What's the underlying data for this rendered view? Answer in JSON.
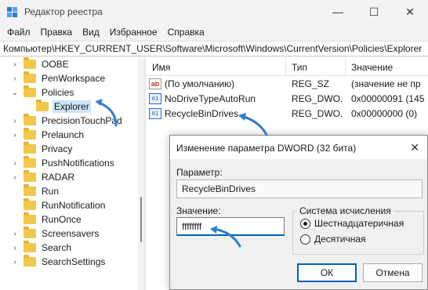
{
  "window": {
    "title": "Редактор реестра"
  },
  "window_controls": {
    "minimize": "—",
    "maximize": "☐",
    "close": "✕"
  },
  "menu": [
    "Файл",
    "Правка",
    "Вид",
    "Избранное",
    "Справка"
  ],
  "address": "Компьютер\\HKEY_CURRENT_USER\\Software\\Microsoft\\Windows\\CurrentVersion\\Policies\\Explorer",
  "tree": {
    "items": [
      {
        "label": "OOBE",
        "expander": "›"
      },
      {
        "label": "PenWorkspace",
        "expander": "›"
      },
      {
        "label": "Policies",
        "expander": "⌄"
      },
      {
        "label": "Explorer",
        "expander": "",
        "selected": true
      },
      {
        "label": "PrecisionTouchPad",
        "expander": "›"
      },
      {
        "label": "Prelaunch",
        "expander": "›"
      },
      {
        "label": "Privacy",
        "expander": ""
      },
      {
        "label": "PushNotifications",
        "expander": "›"
      },
      {
        "label": "RADAR",
        "expander": "›"
      },
      {
        "label": "Run",
        "expander": ""
      },
      {
        "label": "RunNotification",
        "expander": ""
      },
      {
        "label": "RunOnce",
        "expander": ""
      },
      {
        "label": "Screensavers",
        "expander": "›"
      },
      {
        "label": "Search",
        "expander": "›"
      },
      {
        "label": "SearchSettings",
        "expander": "›"
      }
    ]
  },
  "list": {
    "headers": {
      "name": "Имя",
      "type": "Тип",
      "value": "Значение"
    },
    "rows": [
      {
        "icon": "string-value-icon",
        "glyph": "ab",
        "name": "(По умолчанию)",
        "type": "REG_SZ",
        "value": "(значение не пр"
      },
      {
        "icon": "binary-value-icon",
        "glyph": "01",
        "name": "NoDriveTypeAutoRun",
        "type": "REG_DWO...",
        "value": "0x00000091 (145"
      },
      {
        "icon": "binary-value-icon",
        "glyph": "01",
        "name": "RecycleBinDrives",
        "type": "REG_DWO...",
        "value": "0x00000000 (0)"
      }
    ]
  },
  "dialog": {
    "title": "Изменение параметра DWORD (32 бита)",
    "close": "✕",
    "param_label": "Параметр:",
    "param_value": "RecycleBinDrives",
    "value_label": "Значение:",
    "value_text": "ffffffff",
    "base_group_title": "Система исчисления",
    "radio_hex": "Шестнадцатеричная",
    "radio_dec": "Десятичная",
    "selected_base": "hex",
    "ok": "ОК",
    "cancel": "Отмена"
  },
  "colors": {
    "accent": "#0063b1",
    "folder": "#f1c84b",
    "selection": "#cce4f7",
    "annotation_arrow": "#2f7bd6"
  }
}
